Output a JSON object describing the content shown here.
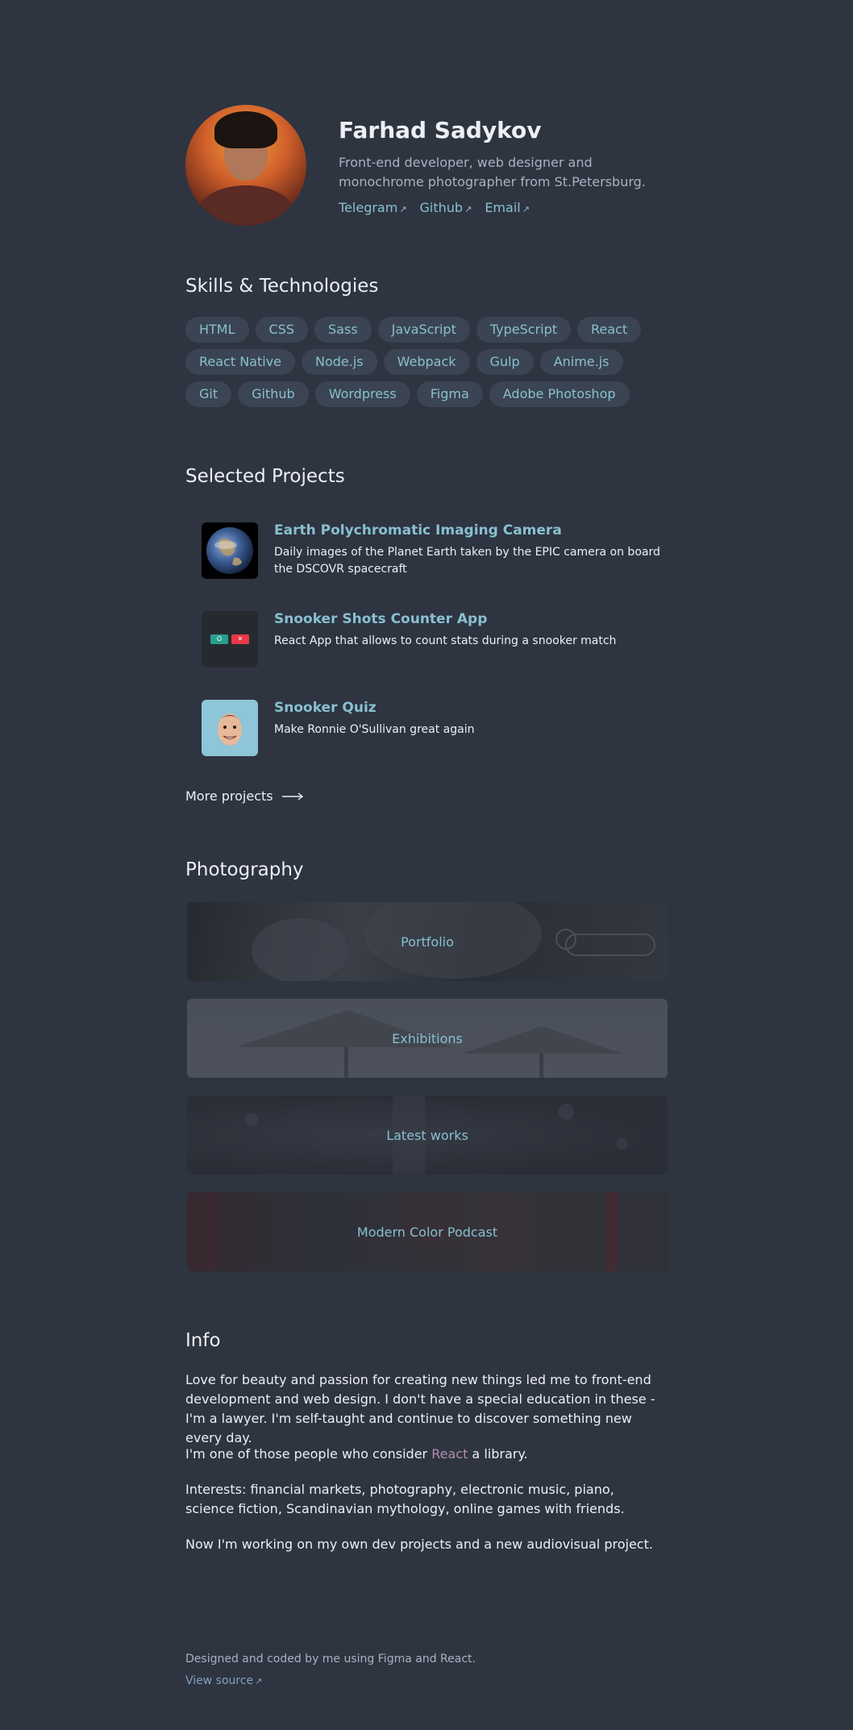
{
  "profile": {
    "name": "Farhad Sadykov",
    "bio": "Front-end developer, web designer and monochrome photographer from St.Petersburg.",
    "links": [
      {
        "label": "Telegram"
      },
      {
        "label": "Github"
      },
      {
        "label": "Email"
      }
    ]
  },
  "skills": {
    "heading": "Skills & Technologies",
    "items": [
      "HTML",
      "CSS",
      "Sass",
      "JavaScript",
      "TypeScript",
      "React",
      "React Native",
      "Node.js",
      "Webpack",
      "Gulp",
      "Anime.js",
      "Git",
      "Github",
      "Wordpress",
      "Figma",
      "Adobe Photoshop"
    ]
  },
  "projects": {
    "heading": "Selected Projects",
    "items": [
      {
        "title": "Earth Polychromatic Imaging Camera",
        "description": "Daily images of the Planet Earth taken by the EPIC camera on board the DSCOVR spacecraft",
        "icon": "earth-icon"
      },
      {
        "title": "Snooker Shots Counter App",
        "description": "React App that allows to count stats during a snooker match",
        "icon": "counter-app-icon"
      },
      {
        "title": "Snooker Quiz",
        "description": "Make Ronnie O'Sullivan great again",
        "icon": "ronnie-face-icon"
      }
    ],
    "more_label": "More projects",
    "counter_icon": {
      "o": "O",
      "x": "✕"
    }
  },
  "photography": {
    "heading": "Photography",
    "items": [
      "Portfolio",
      "Exhibitions",
      "Latest works",
      "Modern Color Podcast"
    ]
  },
  "info": {
    "heading": "Info",
    "p1": "Love for beauty and passion for creating new things led me to front-end development and web design. I don't have a special education in these - I'm a lawyer. I'm self-taught and continue to discover something new every day.",
    "p2_before": "I'm one of those people who consider ",
    "p2_link": "React",
    "p2_after": " a library.",
    "p3": "Interests: financial markets, photography, electronic music, piano, science fiction, Scandinavian mythology, online games with friends.",
    "p4": "Now I'm working on my own dev projects and a new audiovisual project."
  },
  "footer": {
    "text": "Designed and coded by me using Figma and React.",
    "link": "View source"
  },
  "colors": {
    "background": "#2e3440",
    "accent": "#88c0d0",
    "tag_background": "#3b4452",
    "react_link": "#b48ead"
  }
}
